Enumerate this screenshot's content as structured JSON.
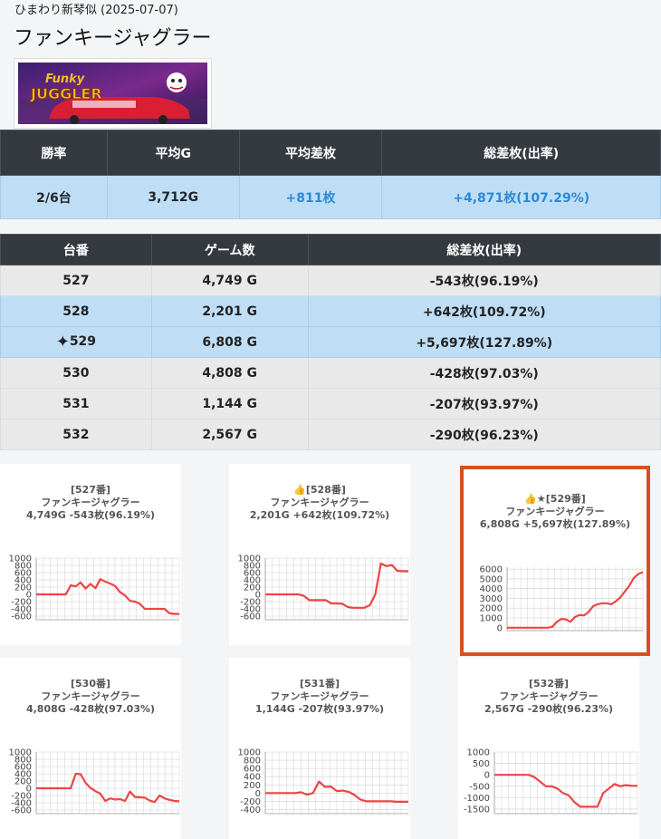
{
  "header": {
    "subtitle": "ひまわり新琴似 (2025-07-07)",
    "title": "ファンキージャグラー",
    "banner_alt": "FUNKY JUGGLER"
  },
  "summary": {
    "headers": [
      "勝率",
      "平均G",
      "平均差枚",
      "総差枚(出率)"
    ],
    "values": [
      "2/6台",
      "3,712G",
      "+811枚",
      "+4,871枚(107.29%)"
    ]
  },
  "machines": {
    "headers": [
      "台番",
      "ゲーム数",
      "総差枚(出率)"
    ],
    "rows": [
      {
        "id": "527",
        "games": "4,749 G",
        "diff": "-543枚(96.19%)",
        "win": false,
        "best": false
      },
      {
        "id": "528",
        "games": "2,201 G",
        "diff": "+642枚(109.72%)",
        "win": true,
        "best": false
      },
      {
        "id": "529",
        "games": "6,808 G",
        "diff": "+5,697枚(127.89%)",
        "win": true,
        "best": true
      },
      {
        "id": "530",
        "games": "4,808 G",
        "diff": "-428枚(97.03%)",
        "win": false,
        "best": false
      },
      {
        "id": "531",
        "games": "1,144 G",
        "diff": "-207枚(93.97%)",
        "win": false,
        "best": false
      },
      {
        "id": "532",
        "games": "2,567 G",
        "diff": "-290枚(96.23%)",
        "win": false,
        "best": false
      }
    ]
  },
  "chart_data": [
    {
      "type": "line",
      "title": "[527番]",
      "subtitle": "ファンキージャグラー",
      "summary": "4,749G -543枚(96.19%)",
      "yticks": [
        1000,
        800,
        600,
        400,
        200,
        0,
        -200,
        -400,
        -600
      ],
      "ylim": [
        -700,
        1000
      ],
      "values": [
        0,
        0,
        0,
        0,
        0,
        0,
        0,
        250,
        220,
        330,
        160,
        290,
        170,
        420,
        350,
        300,
        230,
        60,
        -30,
        -180,
        -200,
        -260,
        -400,
        -400,
        -400,
        -400,
        -400,
        -520,
        -540,
        -540
      ]
    },
    {
      "type": "line",
      "title": "[528番]",
      "prefix": "👍",
      "subtitle": "ファンキージャグラー",
      "summary": "2,201G +642枚(109.72%)",
      "yticks": [
        1000,
        800,
        600,
        400,
        200,
        0,
        -200,
        -400,
        -600
      ],
      "ylim": [
        -700,
        1000
      ],
      "values": [
        0,
        0,
        0,
        0,
        0,
        0,
        0,
        -40,
        -160,
        -160,
        -160,
        -160,
        -250,
        -250,
        -260,
        -350,
        -370,
        -370,
        -370,
        -300,
        0,
        850,
        780,
        810,
        650,
        640,
        640
      ]
    },
    {
      "type": "line",
      "title": "[529番]",
      "prefix": "👍★",
      "subtitle": "ファンキージャグラー",
      "summary": "6,808G +5,697枚(127.89%)",
      "yticks": [
        6000,
        5000,
        4000,
        3000,
        2000,
        1000,
        0
      ],
      "ylim": [
        -300,
        6200
      ],
      "values": [
        0,
        0,
        0,
        0,
        0,
        0,
        0,
        0,
        0,
        0,
        100,
        600,
        900,
        850,
        600,
        1100,
        1300,
        1250,
        1600,
        2200,
        2400,
        2500,
        2500,
        2400,
        2700,
        3100,
        3700,
        4300,
        5100,
        5500,
        5700
      ]
    },
    {
      "type": "line",
      "title": "[530番]",
      "subtitle": "ファンキージャグラー",
      "summary": "4,808G -428枚(97.03%)",
      "yticks": [
        1000,
        800,
        600,
        400,
        200,
        0,
        -200,
        -400,
        -600
      ],
      "ylim": [
        -700,
        1000
      ],
      "values": [
        0,
        0,
        0,
        0,
        0,
        0,
        0,
        0,
        400,
        390,
        150,
        10,
        -80,
        -150,
        -350,
        -280,
        -310,
        -300,
        -350,
        -90,
        -240,
        -250,
        -260,
        -340,
        -380,
        -200,
        -280,
        -320,
        -350,
        -360
      ]
    },
    {
      "type": "line",
      "title": "[531番]",
      "subtitle": "ファンキージャグラー",
      "summary": "1,144G -207枚(93.97%)",
      "yticks": [
        1000,
        800,
        600,
        400,
        200,
        0,
        -200,
        -400
      ],
      "ylim": [
        -500,
        1000
      ],
      "values": [
        0,
        0,
        0,
        0,
        0,
        0,
        20,
        -40,
        0,
        280,
        150,
        160,
        50,
        60,
        30,
        -50,
        -160,
        -200,
        -200,
        -200,
        -200,
        -200,
        -210,
        -210,
        -210
      ]
    },
    {
      "type": "line",
      "title": "[532番]",
      "subtitle": "ファンキージャグラー",
      "summary": "2,567G -290枚(96.23%)",
      "yticks": [
        1000,
        500,
        0,
        -500,
        -1000,
        -1500
      ],
      "ylim": [
        -1700,
        1000
      ],
      "values": [
        0,
        0,
        0,
        0,
        0,
        0,
        0,
        -100,
        -300,
        -500,
        -500,
        -600,
        -800,
        -900,
        -1200,
        -1400,
        -1400,
        -1400,
        -1400,
        -800,
        -600,
        -400,
        -500,
        -450,
        -480,
        -480
      ]
    }
  ],
  "colors": {
    "line": "#ef4444",
    "header_bg": "#343a40",
    "win_bg": "#bfdef6",
    "positive": "#2a8ad8",
    "highlight": "#d9501f"
  }
}
